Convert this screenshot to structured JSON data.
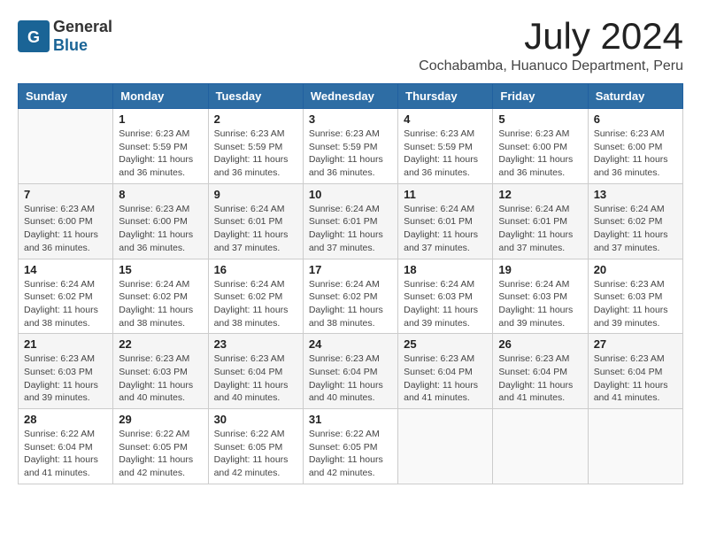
{
  "logo": {
    "text_general": "General",
    "text_blue": "Blue"
  },
  "title": "July 2024",
  "subtitle": "Cochabamba, Huanuco Department, Peru",
  "days_of_week": [
    "Sunday",
    "Monday",
    "Tuesday",
    "Wednesday",
    "Thursday",
    "Friday",
    "Saturday"
  ],
  "weeks": [
    [
      {
        "day": "",
        "info": ""
      },
      {
        "day": "1",
        "info": "Sunrise: 6:23 AM\nSunset: 5:59 PM\nDaylight: 11 hours\nand 36 minutes."
      },
      {
        "day": "2",
        "info": "Sunrise: 6:23 AM\nSunset: 5:59 PM\nDaylight: 11 hours\nand 36 minutes."
      },
      {
        "day": "3",
        "info": "Sunrise: 6:23 AM\nSunset: 5:59 PM\nDaylight: 11 hours\nand 36 minutes."
      },
      {
        "day": "4",
        "info": "Sunrise: 6:23 AM\nSunset: 5:59 PM\nDaylight: 11 hours\nand 36 minutes."
      },
      {
        "day": "5",
        "info": "Sunrise: 6:23 AM\nSunset: 6:00 PM\nDaylight: 11 hours\nand 36 minutes."
      },
      {
        "day": "6",
        "info": "Sunrise: 6:23 AM\nSunset: 6:00 PM\nDaylight: 11 hours\nand 36 minutes."
      }
    ],
    [
      {
        "day": "7",
        "info": "Sunrise: 6:23 AM\nSunset: 6:00 PM\nDaylight: 11 hours\nand 36 minutes."
      },
      {
        "day": "8",
        "info": "Sunrise: 6:23 AM\nSunset: 6:00 PM\nDaylight: 11 hours\nand 36 minutes."
      },
      {
        "day": "9",
        "info": "Sunrise: 6:24 AM\nSunset: 6:01 PM\nDaylight: 11 hours\nand 37 minutes."
      },
      {
        "day": "10",
        "info": "Sunrise: 6:24 AM\nSunset: 6:01 PM\nDaylight: 11 hours\nand 37 minutes."
      },
      {
        "day": "11",
        "info": "Sunrise: 6:24 AM\nSunset: 6:01 PM\nDaylight: 11 hours\nand 37 minutes."
      },
      {
        "day": "12",
        "info": "Sunrise: 6:24 AM\nSunset: 6:01 PM\nDaylight: 11 hours\nand 37 minutes."
      },
      {
        "day": "13",
        "info": "Sunrise: 6:24 AM\nSunset: 6:02 PM\nDaylight: 11 hours\nand 37 minutes."
      }
    ],
    [
      {
        "day": "14",
        "info": "Sunrise: 6:24 AM\nSunset: 6:02 PM\nDaylight: 11 hours\nand 38 minutes."
      },
      {
        "day": "15",
        "info": "Sunrise: 6:24 AM\nSunset: 6:02 PM\nDaylight: 11 hours\nand 38 minutes."
      },
      {
        "day": "16",
        "info": "Sunrise: 6:24 AM\nSunset: 6:02 PM\nDaylight: 11 hours\nand 38 minutes."
      },
      {
        "day": "17",
        "info": "Sunrise: 6:24 AM\nSunset: 6:02 PM\nDaylight: 11 hours\nand 38 minutes."
      },
      {
        "day": "18",
        "info": "Sunrise: 6:24 AM\nSunset: 6:03 PM\nDaylight: 11 hours\nand 39 minutes."
      },
      {
        "day": "19",
        "info": "Sunrise: 6:24 AM\nSunset: 6:03 PM\nDaylight: 11 hours\nand 39 minutes."
      },
      {
        "day": "20",
        "info": "Sunrise: 6:23 AM\nSunset: 6:03 PM\nDaylight: 11 hours\nand 39 minutes."
      }
    ],
    [
      {
        "day": "21",
        "info": "Sunrise: 6:23 AM\nSunset: 6:03 PM\nDaylight: 11 hours\nand 39 minutes."
      },
      {
        "day": "22",
        "info": "Sunrise: 6:23 AM\nSunset: 6:03 PM\nDaylight: 11 hours\nand 40 minutes."
      },
      {
        "day": "23",
        "info": "Sunrise: 6:23 AM\nSunset: 6:04 PM\nDaylight: 11 hours\nand 40 minutes."
      },
      {
        "day": "24",
        "info": "Sunrise: 6:23 AM\nSunset: 6:04 PM\nDaylight: 11 hours\nand 40 minutes."
      },
      {
        "day": "25",
        "info": "Sunrise: 6:23 AM\nSunset: 6:04 PM\nDaylight: 11 hours\nand 41 minutes."
      },
      {
        "day": "26",
        "info": "Sunrise: 6:23 AM\nSunset: 6:04 PM\nDaylight: 11 hours\nand 41 minutes."
      },
      {
        "day": "27",
        "info": "Sunrise: 6:23 AM\nSunset: 6:04 PM\nDaylight: 11 hours\nand 41 minutes."
      }
    ],
    [
      {
        "day": "28",
        "info": "Sunrise: 6:22 AM\nSunset: 6:04 PM\nDaylight: 11 hours\nand 41 minutes."
      },
      {
        "day": "29",
        "info": "Sunrise: 6:22 AM\nSunset: 6:05 PM\nDaylight: 11 hours\nand 42 minutes."
      },
      {
        "day": "30",
        "info": "Sunrise: 6:22 AM\nSunset: 6:05 PM\nDaylight: 11 hours\nand 42 minutes."
      },
      {
        "day": "31",
        "info": "Sunrise: 6:22 AM\nSunset: 6:05 PM\nDaylight: 11 hours\nand 42 minutes."
      },
      {
        "day": "",
        "info": ""
      },
      {
        "day": "",
        "info": ""
      },
      {
        "day": "",
        "info": ""
      }
    ]
  ]
}
